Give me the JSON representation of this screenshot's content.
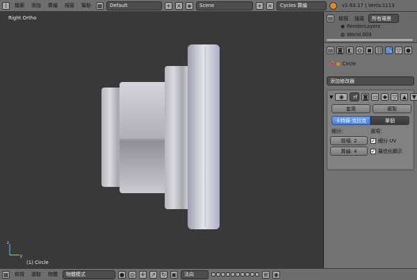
{
  "top_bar": {
    "info_icon": "info-icon",
    "menus": [
      "檔案",
      "添加",
      "算繪",
      "視窗",
      "幫助"
    ],
    "layout": "Default",
    "scene": "Scene",
    "engine": "Cycles 算繪",
    "version": "v2.63.17 | Verts:1113"
  },
  "outliner": {
    "tabs": [
      "檢視",
      "搜尋",
      "所有場景"
    ],
    "items": [
      "RenderLayers",
      "World.003"
    ]
  },
  "viewport": {
    "view_label": "Right Ortho",
    "object_label": "(1) Circle",
    "axes": {
      "y": "y",
      "z": "z"
    }
  },
  "properties": {
    "breadcrumb": "Circle",
    "add_modifier": "添加修改器",
    "modifier_short": "rf",
    "apply": "套用",
    "copy": "複製",
    "tab_catmull": "卡特姆-克拉克",
    "tab_simple": "單個",
    "subdivisions_label": "細分：",
    "options_label": "選項：",
    "view_field": "檢視: 2",
    "render_field": "算繪: 4",
    "subdiv_uv": "細分 UV",
    "optimal_display": "最佳化顯示"
  },
  "bottom_bar": {
    "menus": [
      "檢視",
      "選取",
      "物體"
    ],
    "mode": "物體模式",
    "orientation": "法向"
  }
}
